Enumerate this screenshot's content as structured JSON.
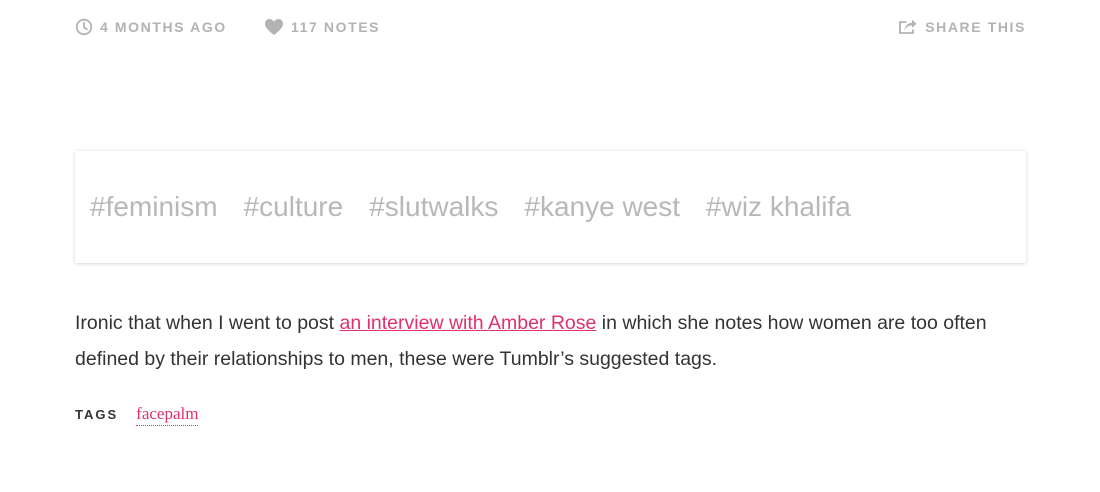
{
  "meta": {
    "time_icon": "clock-icon",
    "time_label": "4 months ago",
    "notes_icon": "heart-icon",
    "notes_label": "117 notes",
    "share_icon": "share-icon",
    "share_label": "Share this"
  },
  "suggested_tags": [
    "#feminism",
    "#culture",
    "#slutwalks",
    "#kanye west",
    "#wiz khalifa"
  ],
  "post": {
    "text_before": "Ironic that when I went to post ",
    "link_text": "an interview with Amber Rose",
    "text_after": " in which she notes how women are too often defined by their relationships to men, these were Tumblr’s suggested tags."
  },
  "tags": {
    "label": "Tags",
    "items": [
      "facepalm"
    ]
  },
  "colors": {
    "accent": "#e0306f",
    "meta_text": "#b3b3b3",
    "suggested_tag_text": "#b8b8b8",
    "body_text": "#333333"
  }
}
